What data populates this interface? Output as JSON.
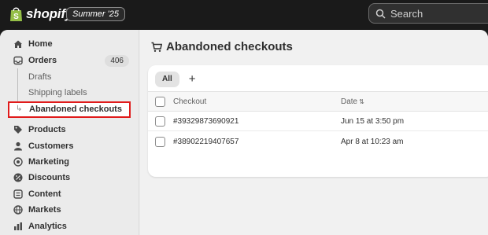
{
  "topbar": {
    "brand": "shopify",
    "edition": "Summer '25",
    "search_placeholder": "Search"
  },
  "sidebar": {
    "items": [
      {
        "label": "Home",
        "icon": "home-icon"
      },
      {
        "label": "Orders",
        "icon": "inbox-icon",
        "badge": "406"
      },
      {
        "label": "Drafts",
        "sub": true
      },
      {
        "label": "Shipping labels",
        "sub": true
      },
      {
        "label": "Abandoned checkouts",
        "sub": true,
        "active": true
      },
      {
        "label": "Products",
        "icon": "tag-icon"
      },
      {
        "label": "Customers",
        "icon": "person-icon"
      },
      {
        "label": "Marketing",
        "icon": "target-icon"
      },
      {
        "label": "Discounts",
        "icon": "discount-icon"
      },
      {
        "label": "Content",
        "icon": "content-icon"
      },
      {
        "label": "Markets",
        "icon": "globe-icon"
      },
      {
        "label": "Analytics",
        "icon": "bar-chart-icon"
      }
    ]
  },
  "page": {
    "title": "Abandoned checkouts",
    "title_icon": "cart-icon"
  },
  "filters": {
    "tabs": [
      {
        "label": "All",
        "selected": true
      }
    ],
    "add_label": "+"
  },
  "table": {
    "columns": {
      "checkout": "Checkout",
      "date": "Date"
    },
    "rows": [
      {
        "checkout": "#39329873690921",
        "date": "Jun 15 at 3:50 pm"
      },
      {
        "checkout": "#38902219407657",
        "date": "Apr 8 at 10:23 am"
      }
    ]
  },
  "colors": {
    "topbar": "#1a1a1a",
    "highlight": "#e01b1b",
    "brand_green": "#95bf47"
  }
}
